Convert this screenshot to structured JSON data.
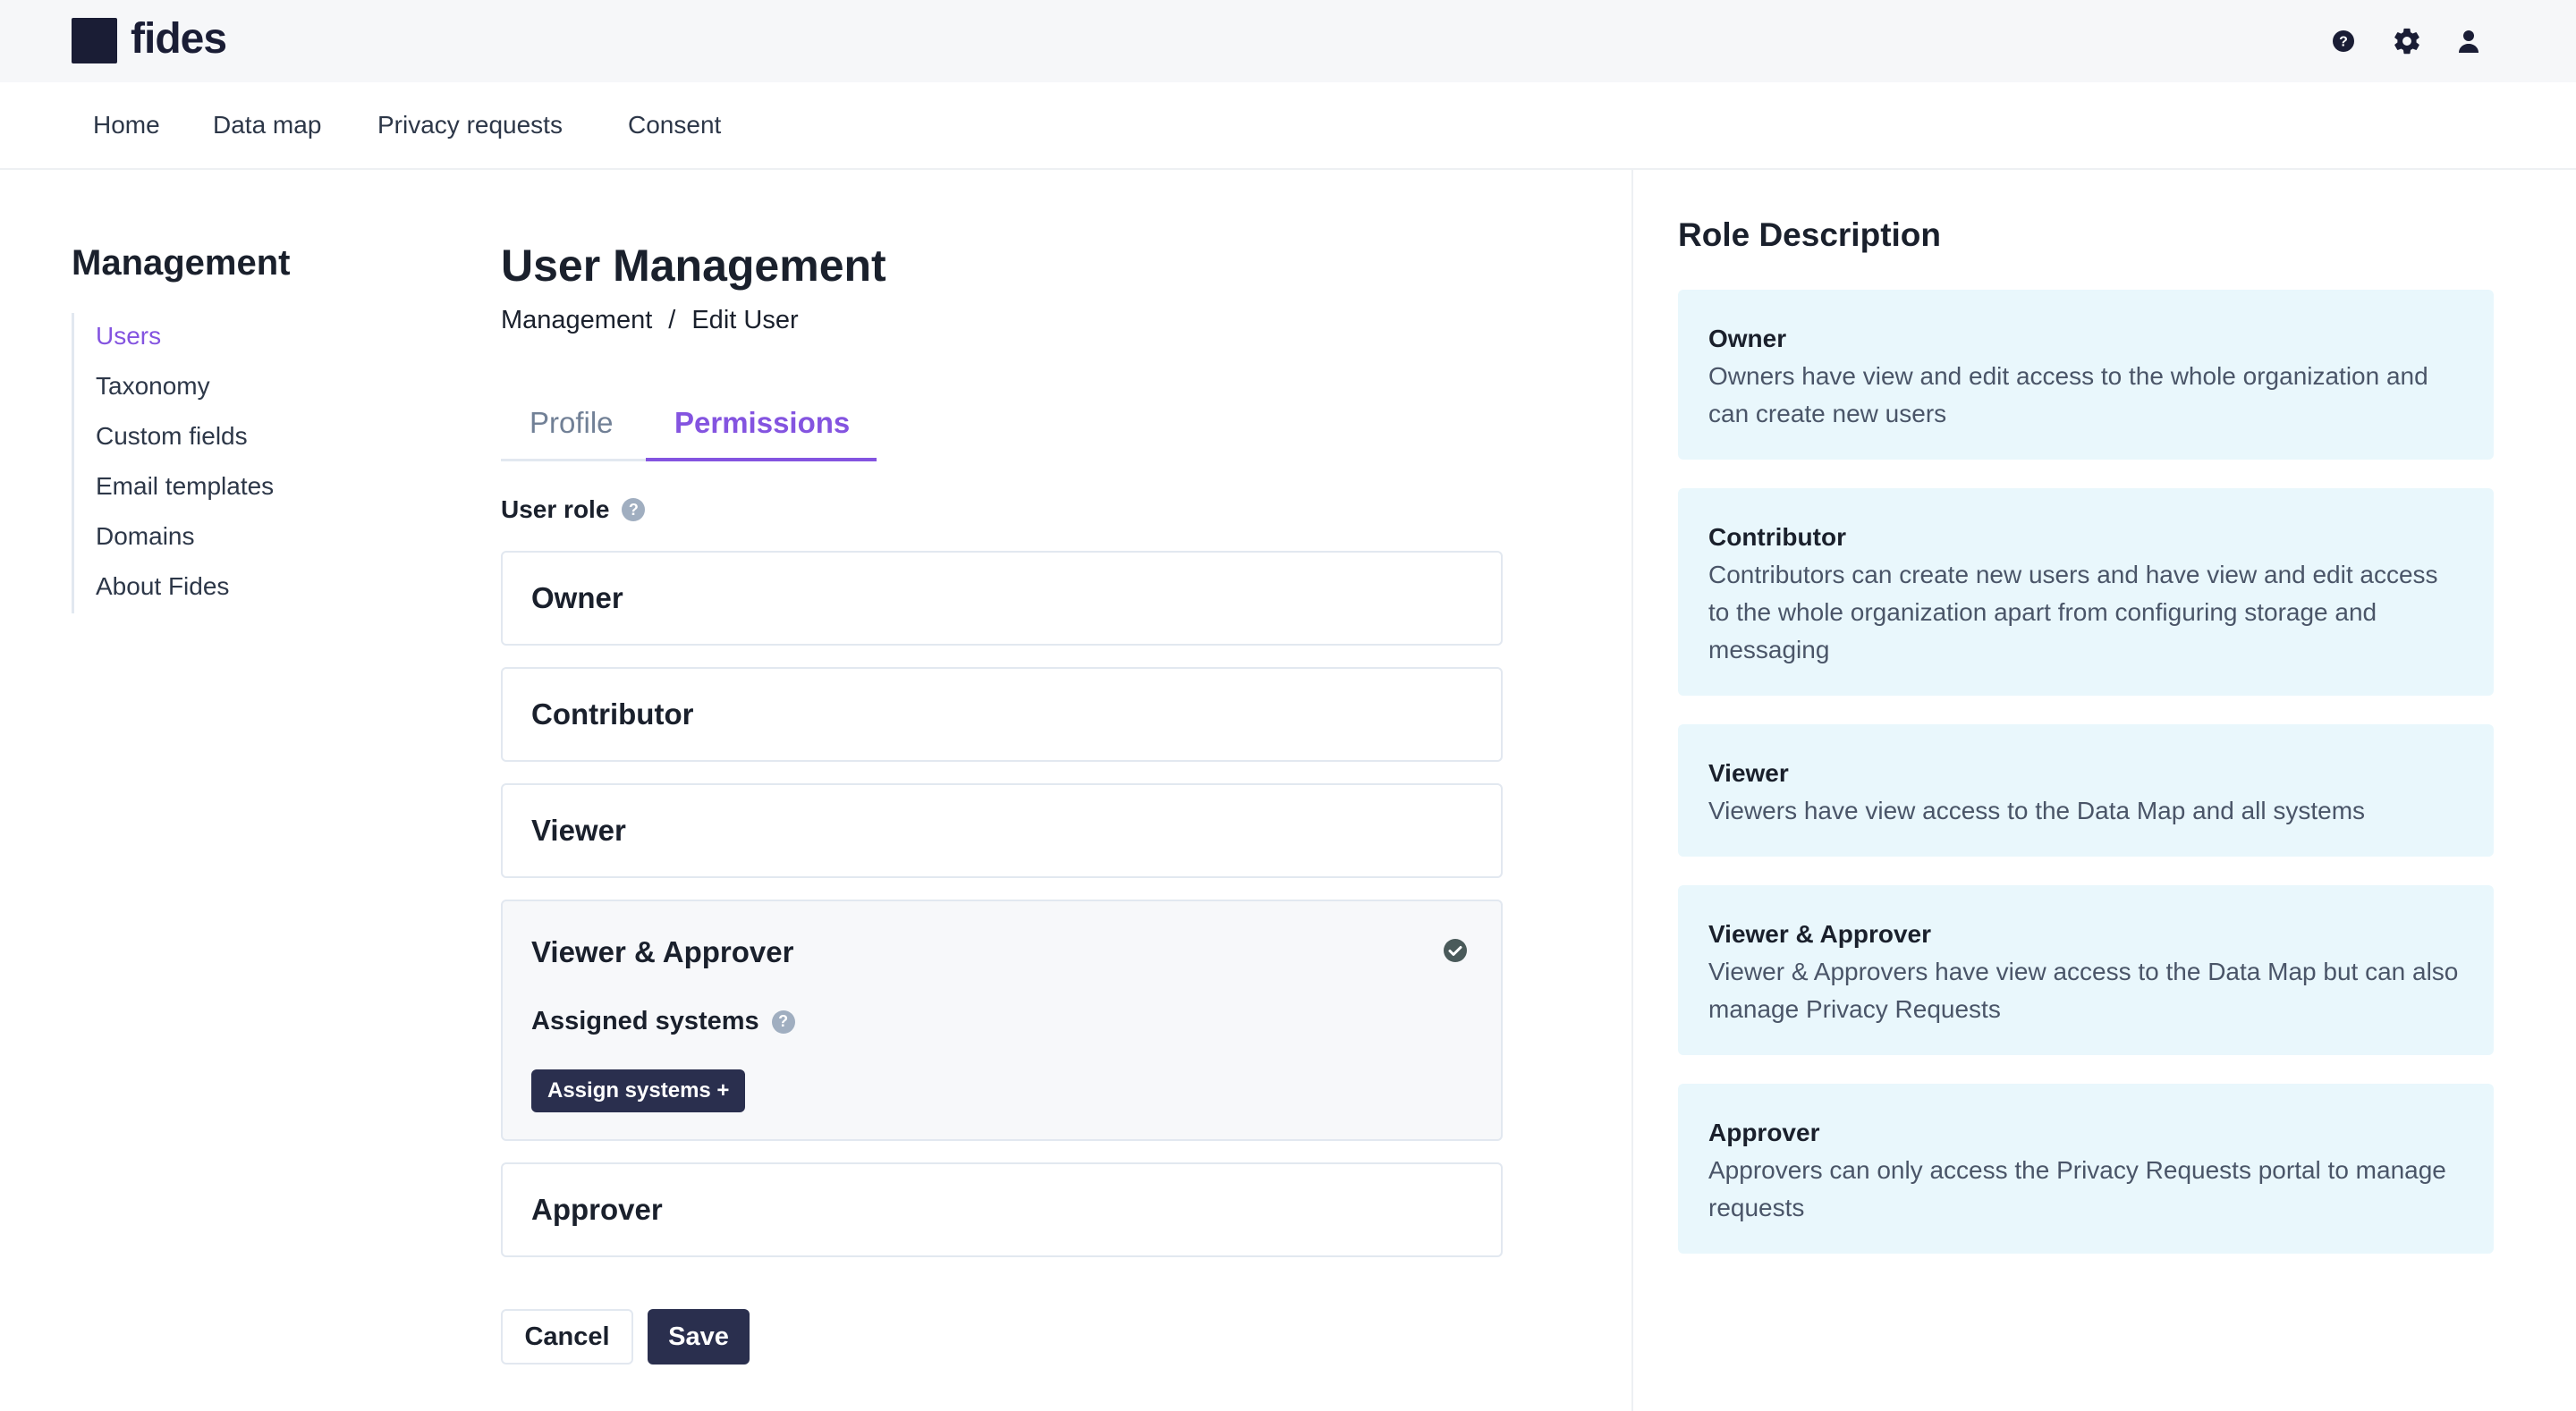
{
  "app": {
    "name": "fides"
  },
  "nav": {
    "items": [
      "Home",
      "Data map",
      "Privacy requests",
      "Consent"
    ]
  },
  "sidebar": {
    "title": "Management",
    "items": [
      "Users",
      "Taxonomy",
      "Custom fields",
      "Email templates",
      "Domains",
      "About Fides"
    ],
    "active": "Users"
  },
  "main": {
    "title": "User Management",
    "breadcrumb": [
      "Management",
      "/",
      "Edit User"
    ],
    "tabs": [
      "Profile",
      "Permissions"
    ],
    "active_tab": "Permissions",
    "user_role_label": "User role",
    "roles": [
      "Owner",
      "Contributor",
      "Viewer",
      "Viewer & Approver",
      "Approver"
    ],
    "selected_role": "Viewer & Approver",
    "assigned_systems_label": "Assigned systems",
    "assign_systems_button": "Assign systems +",
    "cancel_label": "Cancel",
    "save_label": "Save"
  },
  "role_description": {
    "title": "Role Description",
    "items": [
      {
        "name": "Owner",
        "text": "Owners have view and edit access to the whole organization and can create new users"
      },
      {
        "name": "Contributor",
        "text": "Contributors can create new users and have view and edit access to the whole organization apart from configuring storage and messaging"
      },
      {
        "name": "Viewer",
        "text": "Viewers have view access to the Data Map and all systems"
      },
      {
        "name": "Viewer & Approver",
        "text": "Viewer & Approvers have view access to the Data Map but can also manage Privacy Requests"
      },
      {
        "name": "Approver",
        "text": "Approvers can only access the Privacy Requests portal to manage requests"
      }
    ]
  },
  "icons": [
    "help-icon",
    "settings-icon",
    "user-icon",
    "check-circle-icon"
  ],
  "colors": {
    "accent": "#8454e0",
    "primary_button": "#2a2f4e",
    "description_bg": "#e9f7fc"
  }
}
